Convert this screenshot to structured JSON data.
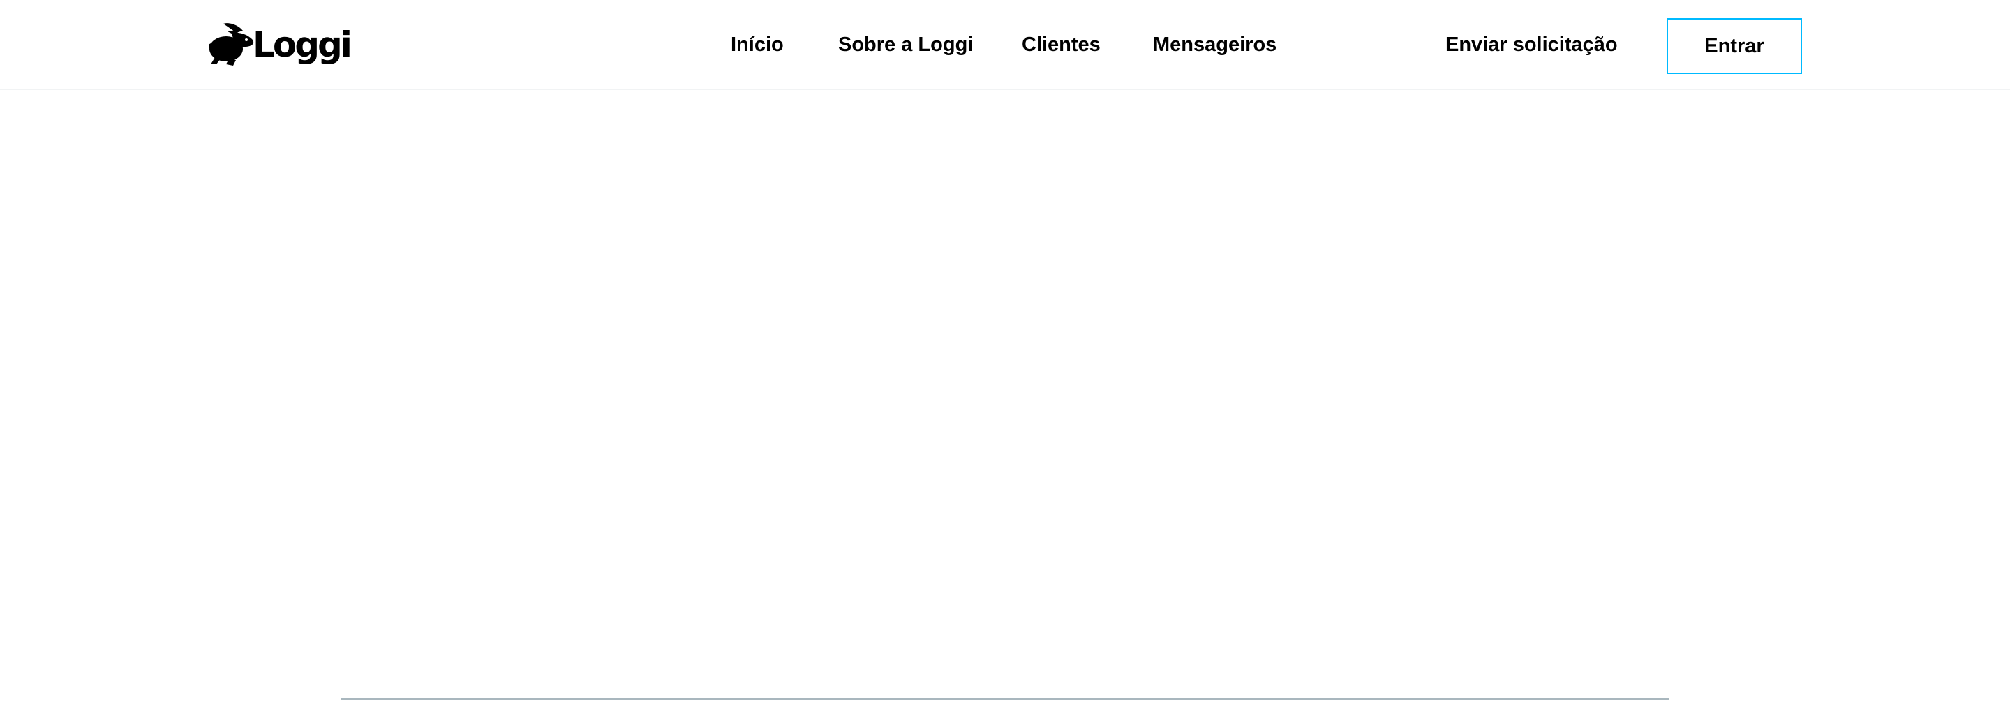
{
  "header": {
    "logo": {
      "text": "Loggi",
      "icon": "rabbit-icon"
    },
    "nav": {
      "inicio": "Início",
      "sobre": "Sobre a Loggi",
      "clientes": "Clientes",
      "mensageiros": "Mensageiros",
      "enviar": "Enviar solicitação"
    },
    "login_button": "Entrar"
  },
  "colors": {
    "login_border": "#00baff",
    "divider": "#a9b7be",
    "text": "#000000",
    "background": "#ffffff"
  }
}
